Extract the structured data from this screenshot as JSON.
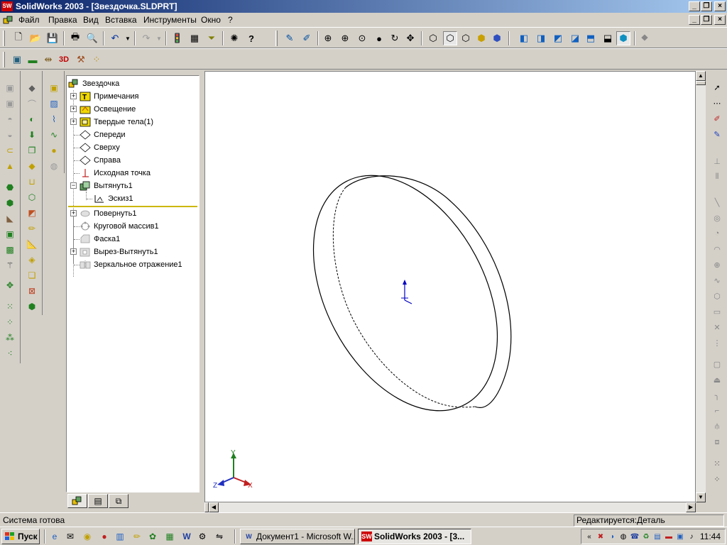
{
  "window": {
    "title": "SolidWorks 2003 - [Звездочка.SLDPRT]",
    "app_icon_text": "SW"
  },
  "menu": [
    "Файл",
    "Правка",
    "Вид",
    "Вставка",
    "Инструменты",
    "Окно",
    "?"
  ],
  "feature_tree": {
    "root": "Звездочка",
    "items": [
      {
        "label": "Примечания",
        "icon": "annotations-icon",
        "expandable": true,
        "suppressed": false
      },
      {
        "label": "Освещение",
        "icon": "lighting-icon",
        "expandable": true,
        "suppressed": false
      },
      {
        "label": "Твердые тела(1)",
        "icon": "solid-bodies-icon",
        "expandable": true,
        "suppressed": false
      },
      {
        "label": "Спереди",
        "icon": "plane-icon",
        "expandable": false,
        "suppressed": false
      },
      {
        "label": "Сверху",
        "icon": "plane-icon",
        "expandable": false,
        "suppressed": false
      },
      {
        "label": "Справа",
        "icon": "plane-icon",
        "expandable": false,
        "suppressed": false
      },
      {
        "label": "Исходная точка",
        "icon": "origin-icon",
        "expandable": false,
        "suppressed": false
      },
      {
        "label": "Вытянуть1",
        "icon": "extrude-icon",
        "expandable": true,
        "expanded": true,
        "suppressed": false
      },
      {
        "label": "Эскиз1",
        "icon": "sketch-icon",
        "expandable": false,
        "suppressed": false,
        "child": true
      },
      {
        "label": "Повернуть1",
        "icon": "revolve-icon",
        "expandable": true,
        "suppressed": true
      },
      {
        "label": "Круговой массив1",
        "icon": "circular-pattern-icon",
        "expandable": false,
        "suppressed": true
      },
      {
        "label": "Фаска1",
        "icon": "chamfer-icon",
        "expandable": false,
        "suppressed": true
      },
      {
        "label": "Вырез-Вытянуть1",
        "icon": "cut-extrude-icon",
        "expandable": true,
        "suppressed": true
      },
      {
        "label": "Зеркальное отражение1",
        "icon": "mirror-icon",
        "expandable": false,
        "suppressed": true
      }
    ]
  },
  "triad": {
    "x": "X",
    "y": "Y",
    "z": "Z"
  },
  "status": {
    "message": "Система готова",
    "mode": "Редактируется:Деталь"
  },
  "taskbar": {
    "start": "Пуск",
    "tasks": [
      {
        "label": "Документ1 - Microsoft W...",
        "active": false
      },
      {
        "label": "SolidWorks 2003 - [3...",
        "active": true
      }
    ],
    "clock": "11:44"
  },
  "colors": {
    "title_start": "#0a246a",
    "title_end": "#a6caf0",
    "rollback_bar": "#ccb800",
    "origin_blue": "#0000c0"
  }
}
